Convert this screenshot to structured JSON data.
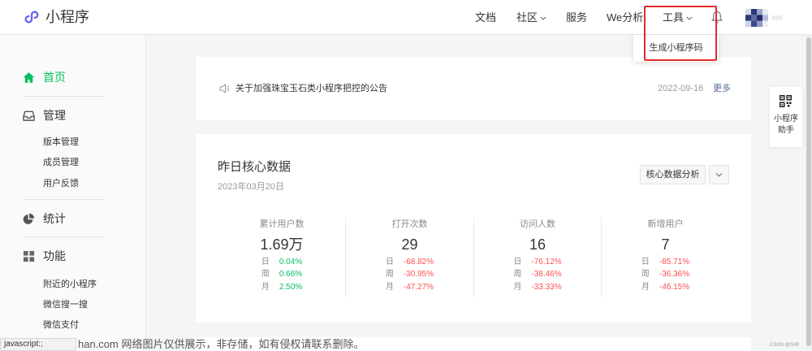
{
  "header": {
    "logo_icon": "mini-program-logo-icon",
    "logo_text": "小程序",
    "nav": [
      {
        "label": "文档"
      },
      {
        "label": "社区",
        "has_dropdown": true
      },
      {
        "label": "服务"
      },
      {
        "label": "We分析"
      },
      {
        "label": "工具",
        "has_dropdown": true,
        "open": true
      }
    ],
    "bell_icon": "bell-icon",
    "avatar_icon": "pixelated-avatar"
  },
  "tools_dropdown": {
    "items": [
      {
        "label": "生成小程序码"
      }
    ]
  },
  "sidebar": {
    "home": {
      "label": "首页",
      "icon": "home-icon",
      "active": true
    },
    "groups": [
      {
        "label": "管理",
        "icon": "inbox-icon",
        "items": [
          {
            "label": "版本管理"
          },
          {
            "label": "成员管理"
          },
          {
            "label": "用户反馈"
          }
        ]
      },
      {
        "label": "统计",
        "icon": "pie-chart-icon",
        "items": []
      },
      {
        "label": "功能",
        "icon": "grid-icon",
        "items": [
          {
            "label": "附近的小程序"
          },
          {
            "label": "微信搜一搜"
          },
          {
            "label": "微信支付"
          }
        ]
      }
    ]
  },
  "notice": {
    "icon": "speaker-icon",
    "text": "关于加强珠宝玉石类小程序把控的公告",
    "date": "2022-09-16",
    "more": "更多"
  },
  "core_data": {
    "title": "昨日核心数据",
    "date": "2023年03月20日",
    "analysis_button": "核心数据分析",
    "stats": [
      {
        "label": "累计用户数",
        "value": "1.69万",
        "rows": [
          {
            "period": "日",
            "change": "0.04%"
          },
          {
            "period": "周",
            "change": "0.66%"
          },
          {
            "period": "月",
            "change": "2.50%"
          }
        ]
      },
      {
        "label": "打开次数",
        "value": "29",
        "rows": [
          {
            "period": "日",
            "change": "-68.82%"
          },
          {
            "period": "周",
            "change": "-30.95%"
          },
          {
            "period": "月",
            "change": "-47.27%"
          }
        ]
      },
      {
        "label": "访问人数",
        "value": "16",
        "rows": [
          {
            "period": "日",
            "change": "-76.12%"
          },
          {
            "period": "周",
            "change": "-38.46%"
          },
          {
            "period": "月",
            "change": "-33.33%"
          }
        ]
      },
      {
        "label": "新增用户",
        "value": "7",
        "rows": [
          {
            "period": "日",
            "change": "-85.71%"
          },
          {
            "period": "周",
            "change": "-36.36%"
          },
          {
            "period": "月",
            "change": "-46.15%"
          }
        ]
      }
    ]
  },
  "assistant": {
    "icon": "qr-code-icon",
    "line1": "小程序",
    "line2": "助手"
  },
  "status_bar": {
    "text": "javascript:;"
  },
  "watermark": {
    "text": "han.com 网络图片仅供展示，非存储，如有侵权请联系删除。"
  },
  "credit": {
    "text": "CSDN @GitP"
  },
  "colors": {
    "accent": "#07c160",
    "up": "#07c160",
    "down": "#fa5151",
    "link": "#576b95",
    "annotation": "#e02b2b",
    "logo": "#6467f0"
  }
}
